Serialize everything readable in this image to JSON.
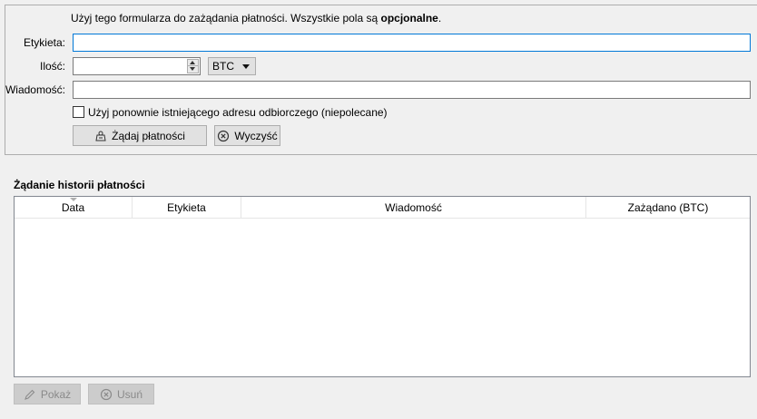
{
  "form": {
    "intro_prefix": "Użyj tego formularza do zażądania płatności. Wszystkie pola są ",
    "intro_bold": "opcjonalne",
    "intro_suffix": ".",
    "label_label": "Etykieta:",
    "amount_label": "Ilość:",
    "message_label": "Wiadomość:",
    "label_value": "",
    "amount_value": "",
    "message_value": "",
    "unit": "BTC",
    "reuse_checkbox_label": "Użyj ponownie istniejącego adresu odbiorczego (niepolecane)",
    "reuse_checked": false,
    "request_button": "Żądaj płatności",
    "clear_button": "Wyczyść"
  },
  "history": {
    "title": "Żądanie historii płatności",
    "columns": [
      "Data",
      "Etykieta",
      "Wiadomość",
      "Zażądano (BTC)"
    ],
    "rows": [],
    "show_button": "Pokaż",
    "remove_button": "Usuń"
  },
  "icons": {
    "request": "request-payment-icon",
    "clear": "clear-icon",
    "show": "edit-icon",
    "remove": "remove-icon"
  }
}
